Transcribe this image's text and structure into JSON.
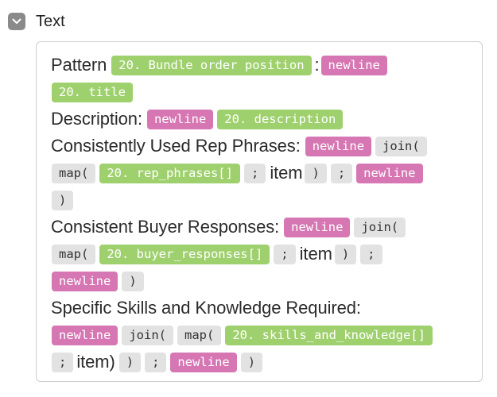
{
  "header": {
    "label": "Text",
    "toggle_icon": "chevron-down-icon"
  },
  "colors": {
    "field_pill": "#9fd06e",
    "newline_pill": "#d677b4",
    "function_pill": "#e2e2e2",
    "toggle_bg": "#8a8a8a"
  },
  "formula": {
    "pattern_label": "Pattern",
    "bundle_position": "20. Bundle order position",
    "colon": ":",
    "newline": "newline",
    "title_field": "20. title",
    "description_label": "Description:",
    "description_field": "20. description",
    "rep_phrases_label": "Consistently Used Rep Phrases:",
    "join_fn": "join(",
    "map_fn": "map(",
    "rep_phrases_field": "20. rep_phrases[]",
    "semicolon": ";",
    "item_word": "item",
    "close_paren": ")",
    "buyer_label": "Consistent Buyer Responses:",
    "buyer_field": "20. buyer_responses[]",
    "skills_label": "Specific Skills and Knowledge Required:",
    "skills_field": "20. skills_and_knowledge[]",
    "item_close": "item)"
  }
}
